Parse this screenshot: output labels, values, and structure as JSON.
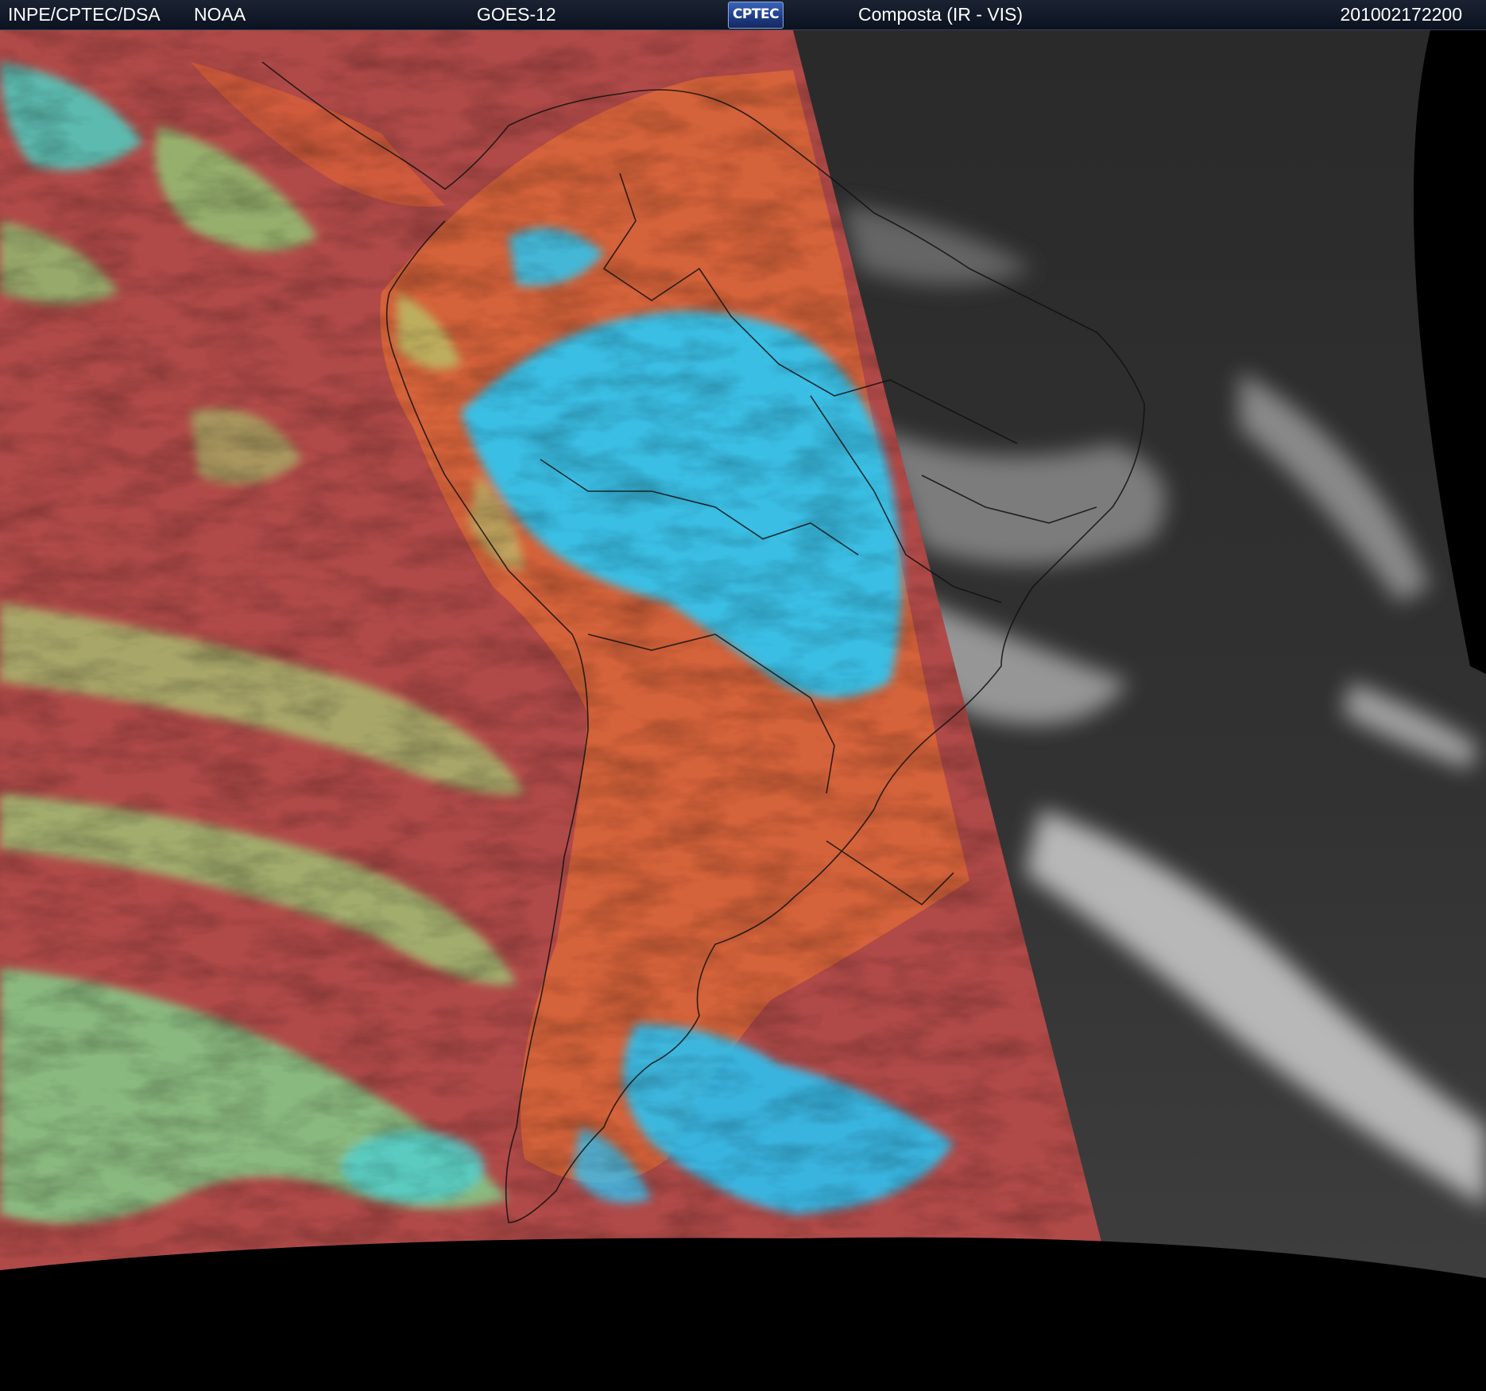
{
  "header": {
    "institution": "INPE/CPTEC/DSA",
    "agency": "NOAA",
    "satellite": "GOES-12",
    "logo_text": "CPTEC",
    "product": "Composta (IR - VIS)",
    "timestamp": "201002172200"
  },
  "colors": {
    "header_bg": "#0e1626",
    "ir_ocean_red": "#b24a48",
    "ir_land_orange": "#d4623a",
    "cold_cloud_cyan": "#28c8f0",
    "mid_cloud_green": "#9ed27a",
    "vis_gray": "#2e2e2e",
    "vis_cloud_white": "#d8d8d8",
    "space_black": "#000000",
    "coastline": "#111111"
  }
}
